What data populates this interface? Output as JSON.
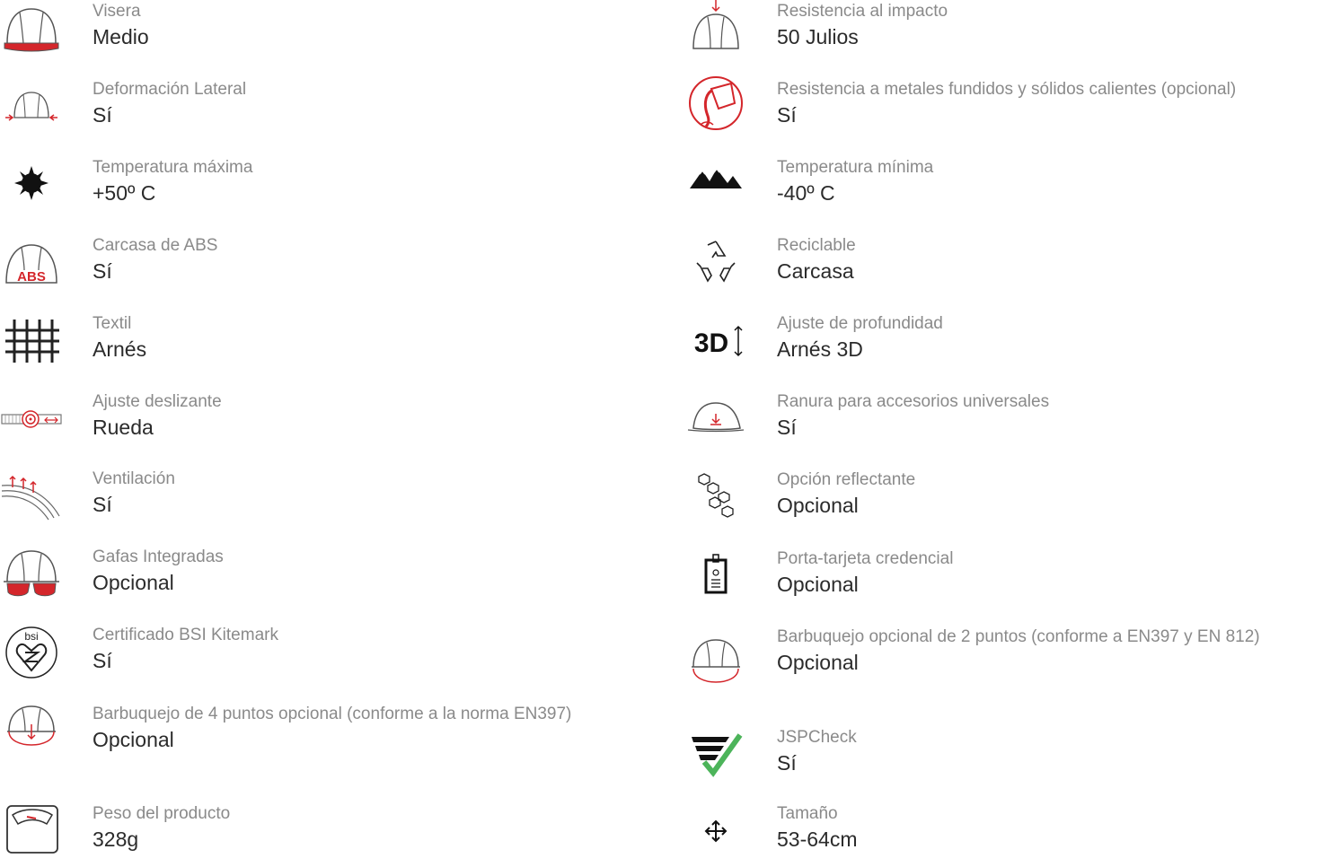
{
  "colors": {
    "accent": "#d4262b",
    "label": "#8a8a8a",
    "value": "#2b2b2b",
    "check": "#4cb45a"
  },
  "left": [
    {
      "icon": "helmet-visor-icon",
      "label": "Visera",
      "value": "Medio"
    },
    {
      "icon": "helmet-lateral-deformation-icon",
      "label": "Deformación Lateral",
      "value": "Sí"
    },
    {
      "icon": "sun-heat-icon",
      "label": "Temperatura máxima",
      "value": "+50º C"
    },
    {
      "icon": "abs-helmet-icon",
      "label": "Carcasa de ABS",
      "value": "Sí",
      "badge": "ABS"
    },
    {
      "icon": "textile-weave-icon",
      "label": "Textil",
      "value": "Arnés"
    },
    {
      "icon": "wheel-ratchet-icon",
      "label": "Ajuste deslizante",
      "value": "Rueda"
    },
    {
      "icon": "ventilation-icon",
      "label": "Ventilación",
      "value": "Sí"
    },
    {
      "icon": "helmet-goggles-icon",
      "label": "Gafas Integradas",
      "value": "Opcional"
    },
    {
      "icon": "bsi-kitemark-icon",
      "label": "Certificado BSI Kitemark",
      "value": "Sí",
      "badge": "bsi"
    },
    {
      "icon": "helmet-4point-chinstrap-icon",
      "label": "Barbuquejo de 4 puntos opcional (conforme a la norma EN397)",
      "value": "Opcional"
    },
    {
      "icon": "weighing-scale-icon",
      "label": "Peso del producto",
      "value": "328g"
    }
  ],
  "right": [
    {
      "icon": "helmet-impact-icon",
      "label": "Resistencia al impacto",
      "value": "50 Julios"
    },
    {
      "icon": "molten-metal-icon",
      "label": "Resistencia a metales fundidos y sólidos calientes (opcional)",
      "value": "Sí"
    },
    {
      "icon": "mountains-cold-icon",
      "label": "Temperatura mínima",
      "value": "-40º C"
    },
    {
      "icon": "recycle-icon",
      "label": "Reciclable",
      "value": "Carcasa"
    },
    {
      "icon": "3d-depth-adjust-icon",
      "label": "Ajuste de profundidad",
      "value": "Arnés 3D",
      "badge": "3D"
    },
    {
      "icon": "accessory-slot-icon",
      "label": "Ranura para accesorios universales",
      "value": "Sí"
    },
    {
      "icon": "reflective-hexagon-icon",
      "label": "Opción reflectante",
      "value": "Opcional"
    },
    {
      "icon": "badge-holder-icon",
      "label": "Porta-tarjeta credencial",
      "value": "Opcional"
    },
    {
      "icon": "helmet-2point-chinstrap-icon",
      "label": "Barbuquejo opcional de 2 puntos (conforme a EN397 y EN 812)",
      "value": "Opcional"
    },
    {
      "icon": "jspcheck-icon",
      "label": "JSPCheck",
      "value": "Sí"
    },
    {
      "icon": "size-arrows-icon",
      "label": "Tamaño",
      "value": "53-64cm"
    }
  ]
}
